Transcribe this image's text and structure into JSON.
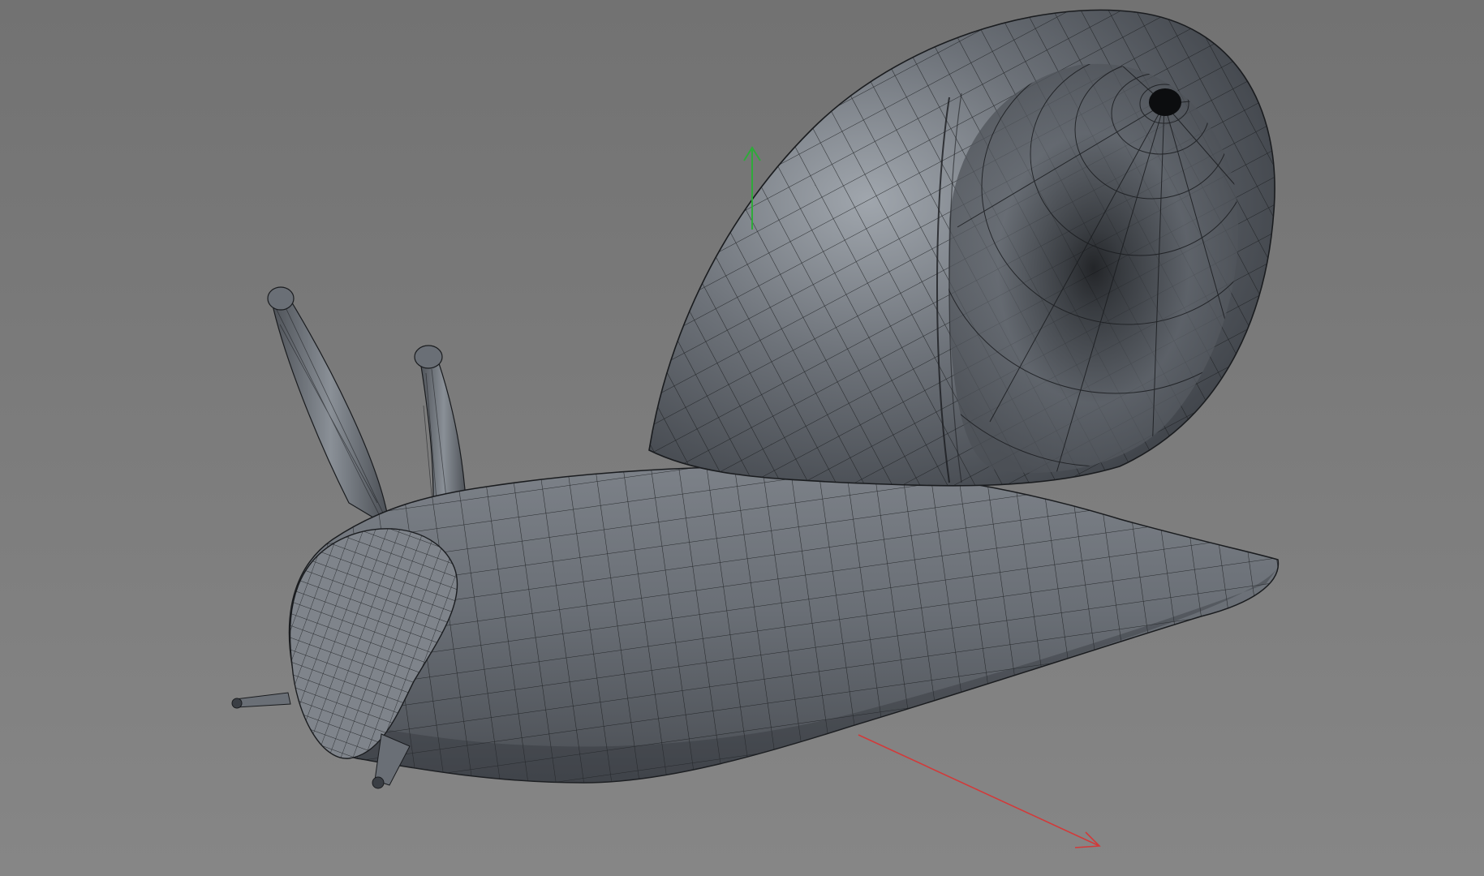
{
  "viewport": {
    "background_top": "#727272",
    "background_bottom": "#868686"
  },
  "model": {
    "surface_color": "#55595f",
    "highlight_color": "#9aa0a6",
    "wire_color": "#1a1c1f"
  },
  "gizmo": {
    "y_axis_color": "#2faa3a",
    "x_axis_color": "#d23a3a"
  }
}
